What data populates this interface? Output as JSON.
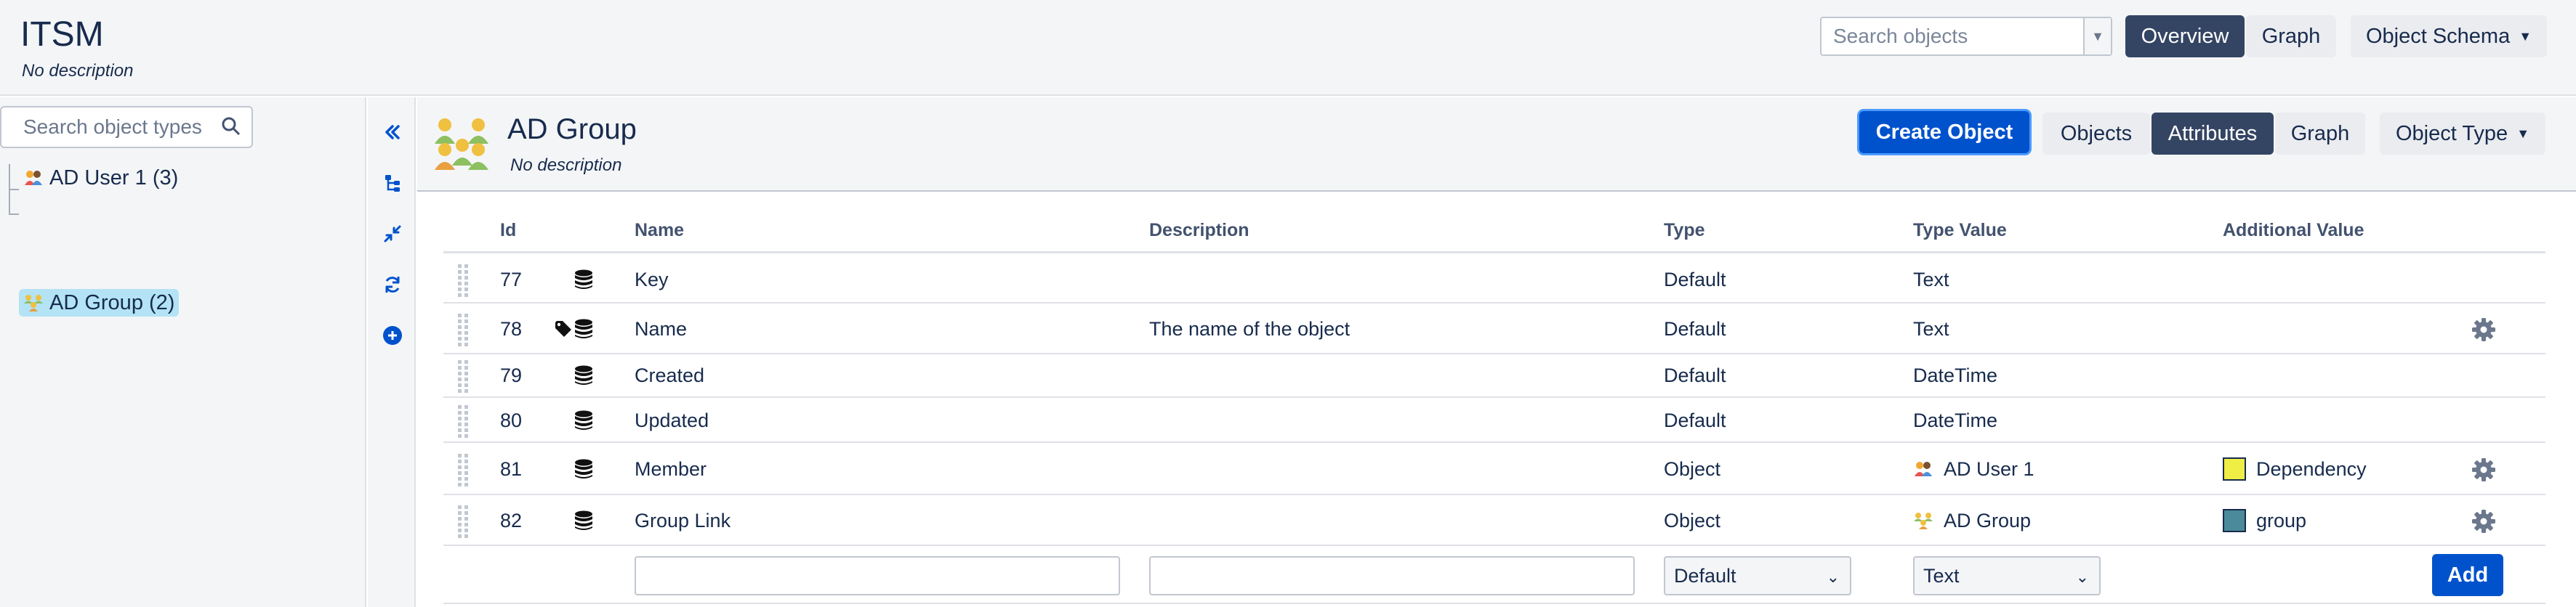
{
  "app": {
    "title": "ITSM",
    "description": "No description"
  },
  "header": {
    "search_placeholder": "Search objects",
    "overview_label": "Overview",
    "graph_label": "Graph",
    "object_schema_label": "Object Schema"
  },
  "sidebar": {
    "search_placeholder": "Search object types",
    "tree": [
      {
        "label": "AD User 1 (3)",
        "icon": "user-group-icon",
        "selected": false
      },
      {
        "label": "AD Group (2)",
        "icon": "group-icon",
        "selected": true
      }
    ]
  },
  "tools": [
    "collapse-icon",
    "hierarchy-icon",
    "compress-icon",
    "refresh-icon",
    "add-circle-icon"
  ],
  "object_type": {
    "title": "AD Group",
    "description": "No description",
    "create_label": "Create Object",
    "tabs": [
      {
        "label": "Objects",
        "active": false
      },
      {
        "label": "Attributes",
        "active": true
      },
      {
        "label": "Graph",
        "active": false
      }
    ],
    "menu_label": "Object Type"
  },
  "attributes": {
    "columns": [
      "Id",
      "Name",
      "Description",
      "Type",
      "Type Value",
      "Additional Value"
    ],
    "rows": [
      {
        "id": "77",
        "name": "Key",
        "description": "",
        "type": "Default",
        "type_value": "Text",
        "additional": "",
        "additional_color": "",
        "tag": false,
        "gear": false,
        "type_value_icon": ""
      },
      {
        "id": "78",
        "name": "Name",
        "description": "The name of the object",
        "type": "Default",
        "type_value": "Text",
        "additional": "",
        "additional_color": "",
        "tag": true,
        "gear": true,
        "type_value_icon": ""
      },
      {
        "id": "79",
        "name": "Created",
        "description": "",
        "type": "Default",
        "type_value": "DateTime",
        "additional": "",
        "additional_color": "",
        "tag": false,
        "gear": false,
        "type_value_icon": ""
      },
      {
        "id": "80",
        "name": "Updated",
        "description": "",
        "type": "Default",
        "type_value": "DateTime",
        "additional": "",
        "additional_color": "",
        "tag": false,
        "gear": false,
        "type_value_icon": ""
      },
      {
        "id": "81",
        "name": "Member",
        "description": "",
        "type": "Object",
        "type_value": "AD User 1",
        "additional": "Dependency",
        "additional_color": "#eeee44",
        "tag": false,
        "gear": true,
        "type_value_icon": "user-group-icon"
      },
      {
        "id": "82",
        "name": "Group Link",
        "description": "",
        "type": "Object",
        "type_value": "AD Group",
        "additional": "group",
        "additional_color": "#4a8a9a",
        "tag": false,
        "gear": true,
        "type_value_icon": "group-icon"
      }
    ],
    "new_row": {
      "name_value": "",
      "description_value": "",
      "type_selected": "Default",
      "type_value_selected": "Text",
      "add_label": "Add"
    }
  },
  "colors": {
    "primary": "#0052cc",
    "dark_button": "#344563",
    "selected_tree": "#b3e3f5"
  }
}
